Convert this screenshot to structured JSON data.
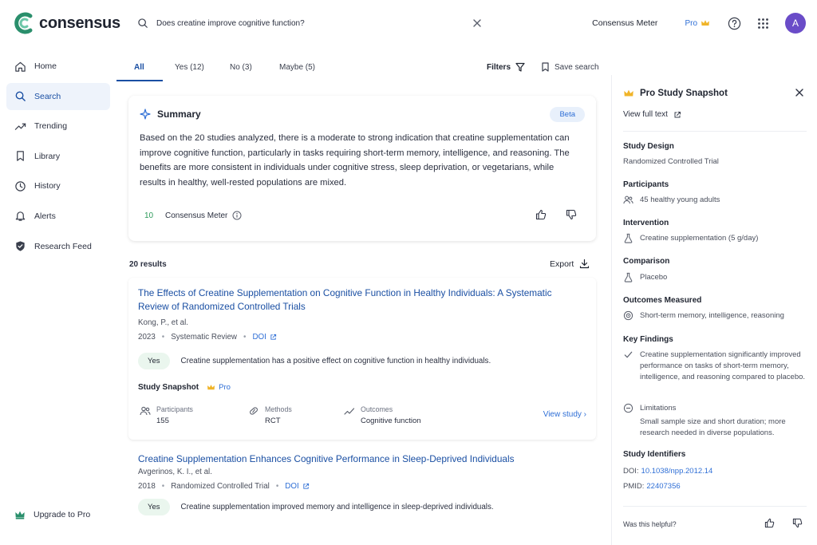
{
  "brand": {
    "name": "consensus",
    "logo_color": "#2a8f6c"
  },
  "sidebar": {
    "items": [
      {
        "label": "Home",
        "icon": "home-icon"
      },
      {
        "label": "Search",
        "icon": "search-icon",
        "active": true
      },
      {
        "label": "Trending",
        "icon": "trending-icon"
      },
      {
        "label": "Library",
        "icon": "bookmark-icon"
      },
      {
        "label": "History",
        "icon": "clock-icon"
      },
      {
        "label": "Alerts",
        "icon": "bell-icon"
      },
      {
        "label": "Research Feed",
        "icon": "shield-icon"
      }
    ],
    "upgrade_label": "Upgrade to Pro"
  },
  "search": {
    "query": "Does creatine improve cognitive function?"
  },
  "header": {
    "consensus_meter": "Consensus Meter",
    "pro": "Pro",
    "avatar_initial": "A"
  },
  "tabs": [
    {
      "label": "All"
    },
    {
      "label": "Yes (12)"
    },
    {
      "label": "No (3)"
    },
    {
      "label": "Maybe (5)"
    }
  ],
  "toolbar": {
    "filters": "Filters",
    "save_search": "Save search"
  },
  "summary": {
    "title": "Summary",
    "badge": "Beta",
    "text": "Based on the 20 studies analyzed, there is a moderate to strong indication that creatine supplementation can improve cognitive function, particularly in tasks requiring short-term memory, intelligence, and reasoning. The benefits are more consistent in individuals under cognitive stress, sleep deprivation, or vegetarians, while results in healthy, well-rested populations are mixed.",
    "meter_value": "10",
    "meter_label": "Consensus Meter"
  },
  "results": {
    "count": "20 results",
    "export": "Export",
    "items": [
      {
        "title": "The Effects of Creatine Supplementation on Cognitive Function in Healthy Individuals: A Systematic Review of Randomized Controlled Trials",
        "authors": "Kong, P., et al.",
        "year": "2023",
        "type": "Systematic Review",
        "doi": "DOI",
        "verdict": "Yes",
        "claim": "Creatine supplementation has a positive effect on cognitive function in healthy individuals.",
        "snapshot_label": "Study Snapshot",
        "snapshot_pro": "Pro",
        "participants_label": "Participants",
        "participants": "155",
        "methods_label": "Methods",
        "methods": "RCT",
        "outcomes_label": "Outcomes",
        "outcomes": "Cognitive function",
        "view_study": "View study"
      },
      {
        "title": "Creatine Supplementation Enhances Cognitive Performance in Sleep-Deprived Individuals",
        "authors": "Avgerinos, K. I., et al.",
        "year": "2018",
        "type": "Randomized Controlled Trial",
        "doi": "DOI",
        "verdict": "Yes",
        "claim": "Creatine supplementation improved memory and intelligence in sleep-deprived individuals."
      }
    ]
  },
  "panel": {
    "title": "Pro Study Snapshot",
    "view_full": "View full text",
    "study_design_label": "Study Design",
    "study_design": "Randomized Controlled Trial",
    "participants_label": "Participants",
    "participants": "45 healthy young adults",
    "intervention_label": "Intervention",
    "intervention": "Creatine supplementation (5 g/day)",
    "comparison_label": "Comparison",
    "comparison": "Placebo",
    "outcomes_label": "Outcomes Measured",
    "outcomes": "Short-term memory, intelligence, reasoning",
    "key_findings_label": "Key Findings",
    "key_findings": "Creatine supplementation significantly improved performance on tasks of short-term memory, intelligence, and reasoning compared to placebo.",
    "limitations_label": "Limitations",
    "limitations": "Small sample size and short duration; more research needed in diverse populations.",
    "identifiers_label": "Study Identifiers",
    "doi_prefix": "DOI:",
    "doi": "10.1038/npp.2012.14",
    "pmid_prefix": "PMID:",
    "pmid": "22407356",
    "helpful": "Was this helpful?"
  }
}
